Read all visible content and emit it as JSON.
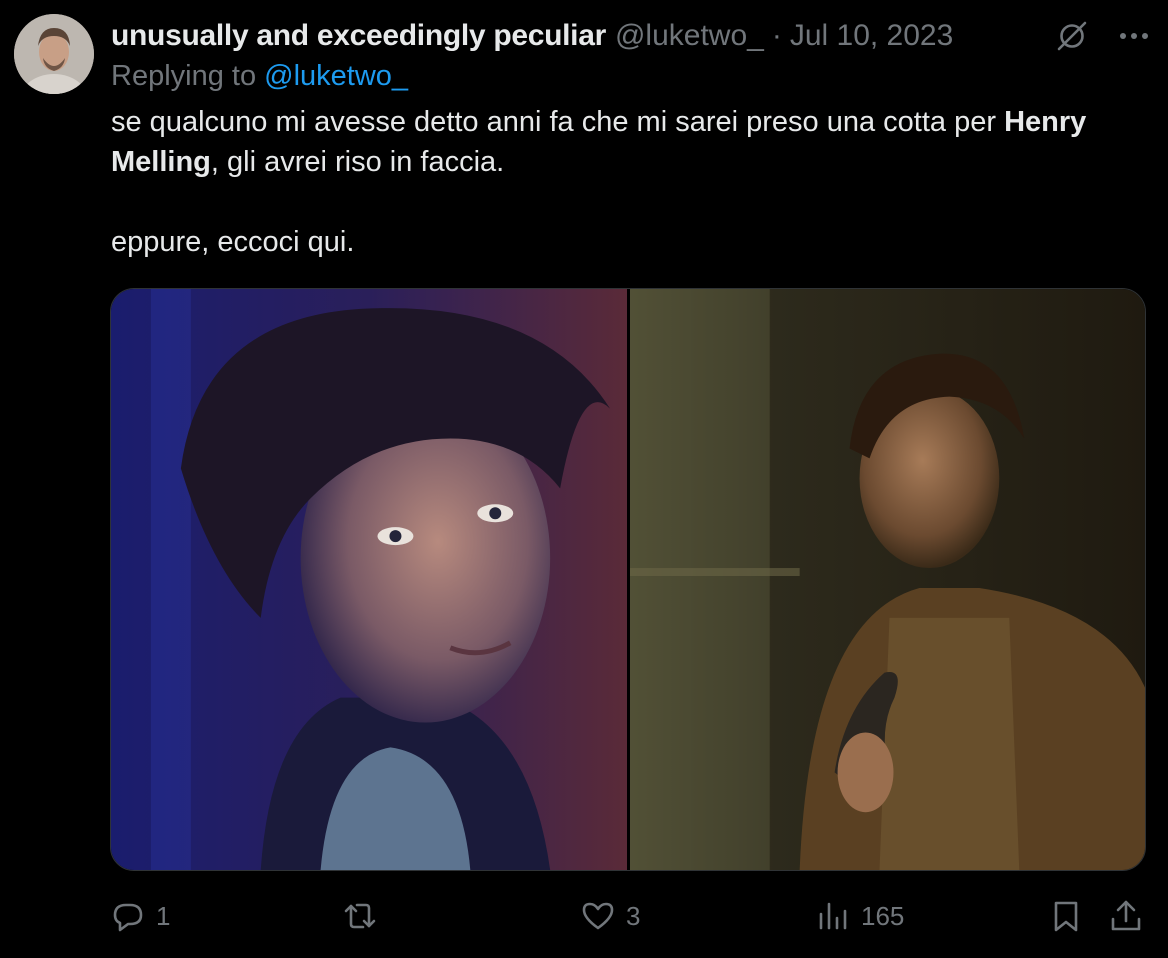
{
  "author": {
    "display_name": "unusually and exceedingly peculiar",
    "handle": "@luketwo_",
    "separator": "·",
    "date": "Jul 10, 2023"
  },
  "reply": {
    "prefix": "Replying to ",
    "mention": "@luketwo_"
  },
  "body": {
    "line1_before": "se qualcuno mi avesse detto anni fa che mi sarei preso una cotta per ",
    "bold_name": "Henry Melling",
    "line1_after": ", gli avrei riso in faccia.",
    "paragraph2": "eppure, eccoci qui."
  },
  "icons": {
    "grok": "slashed-circle-icon",
    "more": "more-dots-icon",
    "reply": "reply-bubble-icon",
    "retweet": "retweet-icon",
    "like": "heart-icon",
    "views": "views-bars-icon",
    "bookmark": "bookmark-icon",
    "share": "share-upload-icon"
  },
  "actions": {
    "reply_count": "1",
    "retweet_count": "",
    "like_count": "3",
    "views_count": "165"
  },
  "colors": {
    "background": "#000000",
    "text": "#e7e9ea",
    "muted": "#71767b",
    "link": "#1d9bf0"
  }
}
